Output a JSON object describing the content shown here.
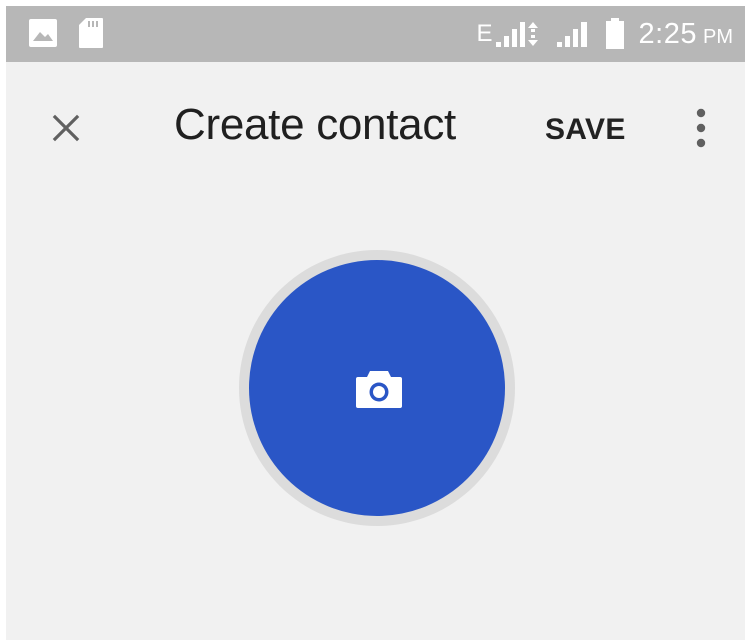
{
  "status_bar": {
    "network_type": "E",
    "time": "2:25",
    "time_suffix": "PM",
    "icons": [
      "image-notification-icon",
      "sd-card-icon",
      "signal-sim1-icon",
      "data-activity-icon",
      "signal-sim2-icon",
      "battery-icon"
    ]
  },
  "toolbar": {
    "close_icon": "close-icon",
    "title": "Create contact",
    "save_label": "SAVE",
    "more_icon": "more-vert-icon"
  },
  "photo": {
    "icon": "camera-icon",
    "color": "#2a56c6"
  },
  "colors": {
    "status_bar": "#b7b7b7",
    "background": "#f1f1f1",
    "accent": "#2a56c6"
  }
}
